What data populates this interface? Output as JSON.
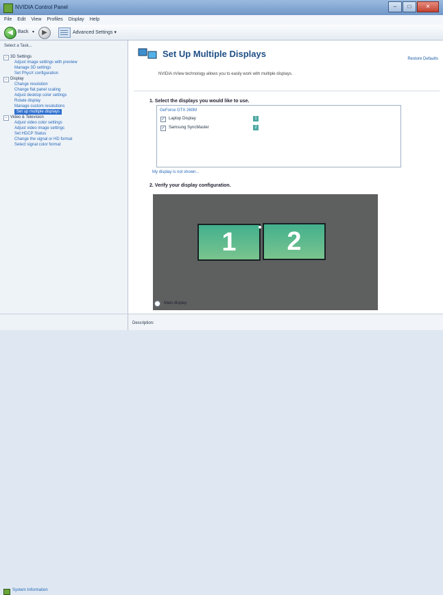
{
  "window": {
    "title": "NVIDIA Control Panel",
    "minimize_glyph": "–",
    "maximize_glyph": "□",
    "close_glyph": "✕"
  },
  "menubar": {
    "items": [
      "File",
      "Edit",
      "View",
      "Profiles",
      "Display",
      "Help"
    ]
  },
  "toolbar": {
    "back_glyph": "◀",
    "back_label": "Back",
    "back_chevron": "▾",
    "forward_glyph": "▶",
    "advanced_label": "Advanced Settings ▾"
  },
  "sidebar": {
    "header": "Select a Task...",
    "categories": [
      {
        "toggle": "−",
        "label": "3D Settings",
        "items": [
          "Adjust image settings with preview",
          "Manage 3D settings",
          "Set PhysX configuration"
        ]
      },
      {
        "toggle": "−",
        "label": "Display",
        "items": [
          "Change resolution",
          "Change flat panel scaling",
          "Adjust desktop color settings",
          "Rotate display",
          "Manage custom resolutions",
          "Set up multiple displays"
        ],
        "selected_index": 5
      },
      {
        "toggle": "−",
        "label": "Video & Television",
        "items": [
          "Adjust video color settings",
          "Adjust video image settings",
          "Set HDCP Status",
          "Change the signal or HD format",
          "Select signal color format"
        ]
      }
    ],
    "system_info": "System Information"
  },
  "main": {
    "title": "Set Up Multiple Displays",
    "restore_defaults": "Restore Defaults",
    "description": "NVIDIA nView technology allows you to easily work with multiple displays.",
    "section1_title": "1. Select the displays you would like to use.",
    "gpu_label": "GeForce GTX 260M",
    "displays": [
      {
        "name": "Laptop Display",
        "checked": "✓",
        "badge": "1"
      },
      {
        "name": "Samsung SyncMaster",
        "checked": "✓",
        "badge": "2"
      }
    ],
    "missing_link": "My display is not shown...",
    "section2_title": "2. Verify your display configuration.",
    "monitors": [
      "1",
      "2"
    ],
    "main_display_label": "Main display"
  },
  "status": {
    "text": "Description:"
  },
  "colors": {
    "accent": "#2e6fcf",
    "title_blue": "#1f4f85",
    "monitor_green": "#43b08d",
    "stage_gray": "#5e6060"
  }
}
